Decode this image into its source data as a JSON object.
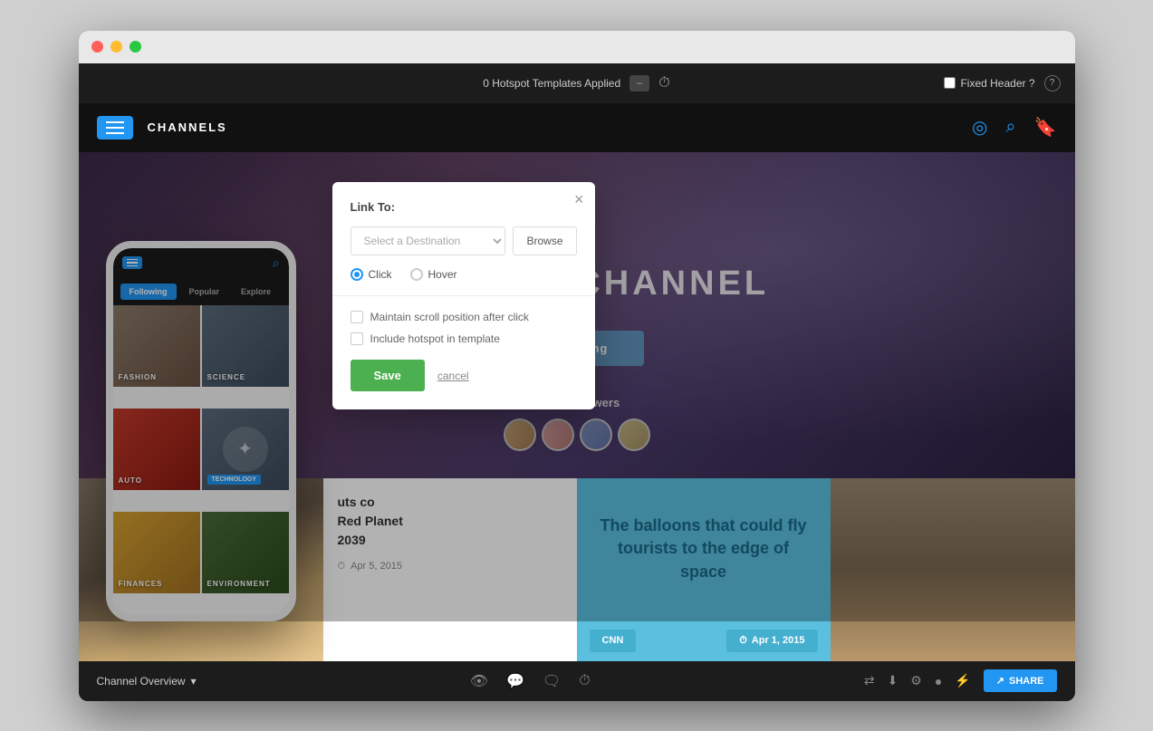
{
  "browser": {
    "traffic_lights": [
      "red",
      "yellow",
      "green"
    ]
  },
  "top_toolbar": {
    "hotspot_label": "0 Hotspot Templates Applied",
    "dropdown_btn": "–",
    "clock_icon": "⏱",
    "fixed_header_label": "Fixed Header ?",
    "help_label": "?"
  },
  "app_header": {
    "channels_label": "CHANNELS",
    "icons": [
      "◎",
      "🔍",
      "🔖"
    ]
  },
  "hero": {
    "title": "SCIENCE CHANNEL",
    "following_btn": "Following",
    "followers_count": "234K Followers"
  },
  "article_card": {
    "excerpt": "uts co\nRed Planet\n2039",
    "date": "Apr 5, 2015"
  },
  "balloon_card": {
    "title": "The balloons that could fly tourists to the edge of space",
    "tag_left": "CNN",
    "date_right": "Apr 1, 2015"
  },
  "phone": {
    "tabs": [
      {
        "label": "Following",
        "active": true
      },
      {
        "label": "Popular",
        "active": false
      },
      {
        "label": "Explore",
        "active": false
      }
    ],
    "cards": [
      {
        "label": "FASHION",
        "type": "fashion"
      },
      {
        "label": "SCIENCE",
        "type": "science"
      },
      {
        "label": "AUTO",
        "type": "auto"
      },
      {
        "label": "TECHNOLOGY",
        "type": "tech",
        "badge": true
      },
      {
        "label": "FINANCES",
        "type": "finance"
      },
      {
        "label": "ENVIRONMENT",
        "type": "env"
      }
    ]
  },
  "modal": {
    "title": "Link To:",
    "destination_placeholder": "Select a Destination",
    "browse_label": "Browse",
    "click_label": "Click",
    "hover_label": "Hover",
    "checkbox1": "Maintain scroll position after click",
    "checkbox2": "Include hotspot in template",
    "save_label": "Save",
    "cancel_label": "cancel"
  },
  "bottom_toolbar": {
    "channel_overview": "Channel Overview",
    "dropdown": "▾",
    "share_label": "SHARE",
    "icons": [
      "👁",
      "💬",
      "🗨",
      "⏱"
    ]
  }
}
